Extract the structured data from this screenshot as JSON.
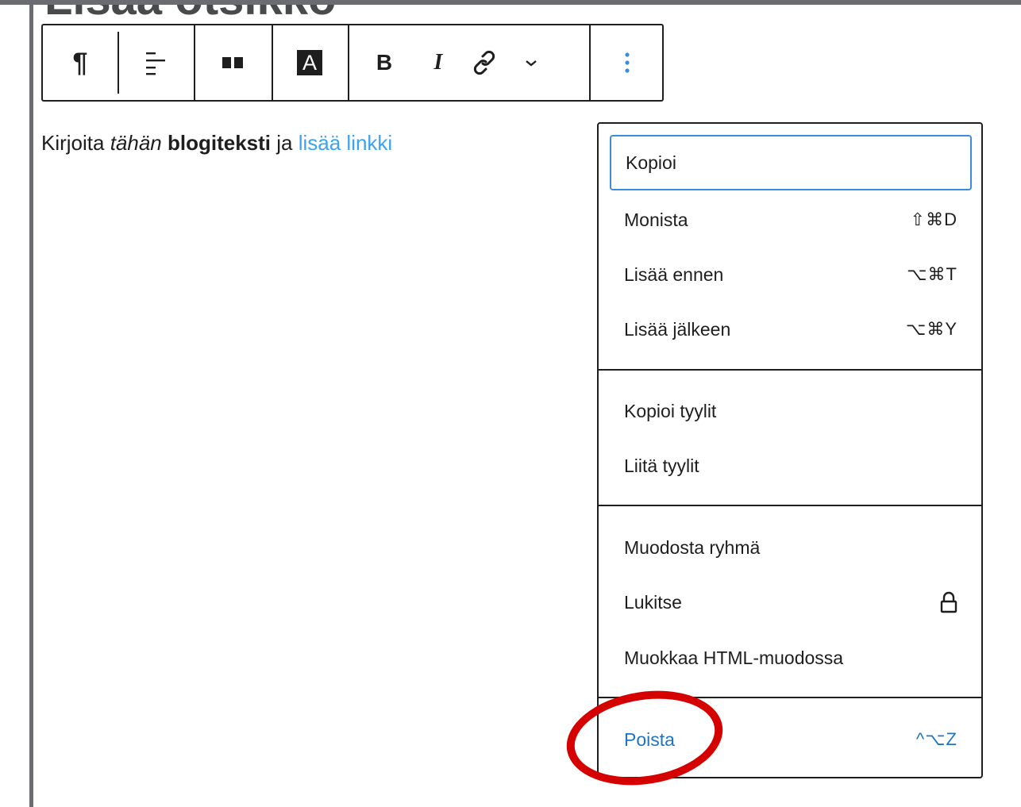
{
  "heading": {
    "text": "Lisää otsikko"
  },
  "toolbar": {
    "paragraph_icon": "pilcrow-icon",
    "align_icon": "align-icon",
    "columns_icon": "columns-icon",
    "text_color_label": "A",
    "bold_label": "B",
    "italic_label": "I",
    "link_icon": "link-icon",
    "more_icon": "chevron-down-icon",
    "options_icon": "kebab-icon"
  },
  "content": {
    "part1": "Kirjoita ",
    "italic": "tähän",
    "part2": " ",
    "bold": "blogiteksti",
    "part3": " ja ",
    "link": "lisää linkki"
  },
  "menu": {
    "copy": {
      "label": "Kopioi"
    },
    "duplicate": {
      "label": "Monista",
      "shortcut": "⇧⌘D"
    },
    "insert_before": {
      "label": "Lisää ennen",
      "shortcut": "⌥⌘T"
    },
    "insert_after": {
      "label": "Lisää jälkeen",
      "shortcut": "⌥⌘Y"
    },
    "copy_styles": {
      "label": "Kopioi tyylit"
    },
    "paste_styles": {
      "label": "Liitä tyylit"
    },
    "group": {
      "label": "Muodosta ryhmä"
    },
    "lock": {
      "label": "Lukitse",
      "icon": "lock-icon"
    },
    "edit_html": {
      "label": "Muokkaa HTML-muodossa"
    },
    "delete": {
      "label": "Poista",
      "shortcut": "^⌥Z"
    }
  },
  "colors": {
    "accent": "#3a8dde",
    "delete": "#1f74c4",
    "link": "#3ea2f2",
    "highlight": "#d50000"
  }
}
